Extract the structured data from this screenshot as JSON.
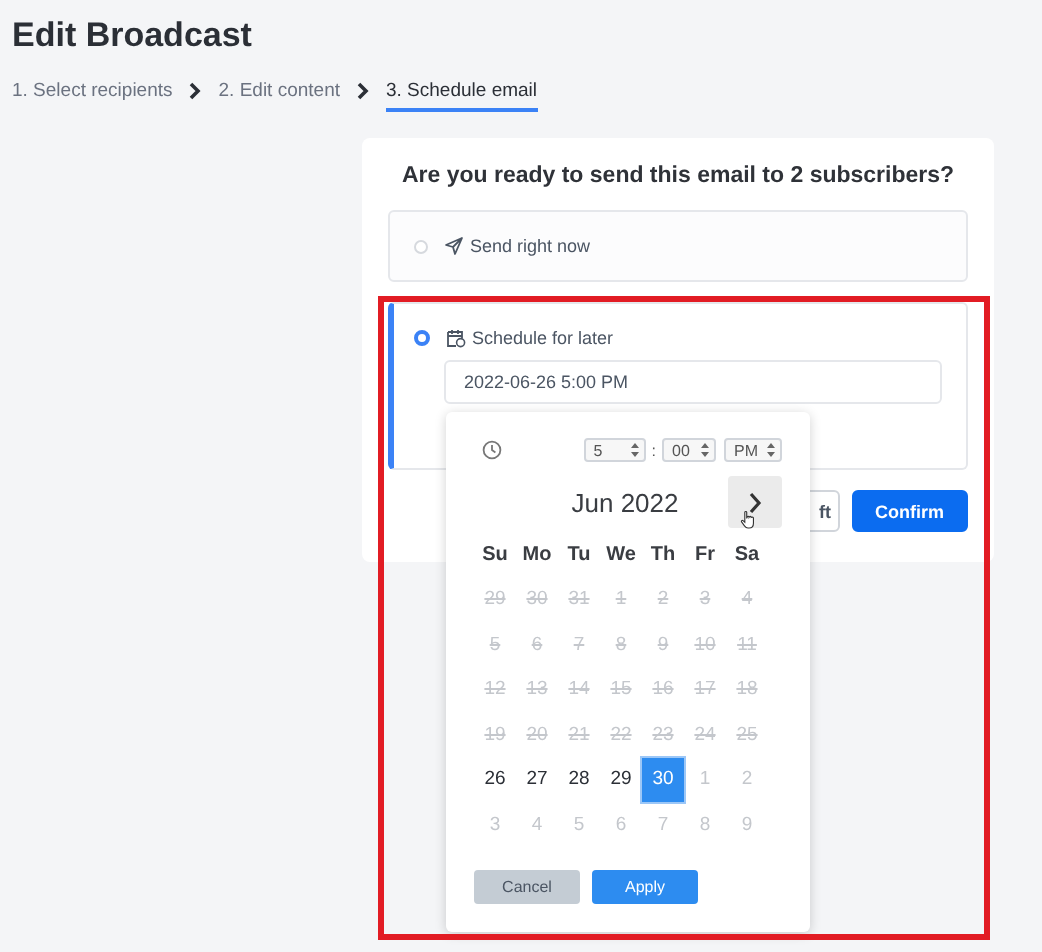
{
  "page": {
    "title": "Edit Broadcast"
  },
  "steps": [
    {
      "label": "1. Select recipients",
      "selected": false
    },
    {
      "label": "2. Edit content",
      "selected": false
    },
    {
      "label": "3. Schedule email",
      "selected": true
    }
  ],
  "card": {
    "question": "Are you ready to send this email to 2 subscribers?",
    "options": [
      {
        "kind": "now",
        "label": "Send right now",
        "selected": false
      },
      {
        "kind": "scheduled",
        "label": "Schedule for later",
        "selected": true,
        "value": "2022-06-26 5:00 PM"
      }
    ],
    "buttons": [
      {
        "label": "ft",
        "kind": "secondary"
      },
      {
        "label": "Confirm",
        "kind": "primary"
      }
    ]
  },
  "datepicker": {
    "hour": "5",
    "separator": ":",
    "minute": "00",
    "period": "PM",
    "month": "Jun 2022",
    "weekdays": [
      "Su",
      "Mo",
      "Tu",
      "We",
      "Th",
      "Fr",
      "Sa"
    ],
    "days": [
      {
        "label": "29",
        "kind": "disabled",
        "selected": false
      },
      {
        "label": "30",
        "kind": "disabled",
        "selected": false
      },
      {
        "label": "31",
        "kind": "disabled",
        "selected": false
      },
      {
        "label": "1",
        "kind": "disabled",
        "selected": false
      },
      {
        "label": "2",
        "kind": "disabled",
        "selected": false
      },
      {
        "label": "3",
        "kind": "disabled",
        "selected": false
      },
      {
        "label": "4",
        "kind": "disabled",
        "selected": false
      },
      {
        "label": "5",
        "kind": "disabled",
        "selected": false
      },
      {
        "label": "6",
        "kind": "disabled",
        "selected": false
      },
      {
        "label": "7",
        "kind": "disabled",
        "selected": false
      },
      {
        "label": "8",
        "kind": "disabled",
        "selected": false
      },
      {
        "label": "9",
        "kind": "disabled",
        "selected": false
      },
      {
        "label": "10",
        "kind": "disabled",
        "selected": false
      },
      {
        "label": "11",
        "kind": "disabled",
        "selected": false
      },
      {
        "label": "12",
        "kind": "disabled",
        "selected": false
      },
      {
        "label": "13",
        "kind": "disabled",
        "selected": false
      },
      {
        "label": "14",
        "kind": "disabled",
        "selected": false
      },
      {
        "label": "15",
        "kind": "disabled",
        "selected": false
      },
      {
        "label": "16",
        "kind": "disabled",
        "selected": false
      },
      {
        "label": "17",
        "kind": "disabled",
        "selected": false
      },
      {
        "label": "18",
        "kind": "disabled",
        "selected": false
      },
      {
        "label": "19",
        "kind": "disabled",
        "selected": false
      },
      {
        "label": "20",
        "kind": "disabled",
        "selected": false
      },
      {
        "label": "21",
        "kind": "disabled",
        "selected": false
      },
      {
        "label": "22",
        "kind": "disabled",
        "selected": false
      },
      {
        "label": "23",
        "kind": "disabled",
        "selected": false
      },
      {
        "label": "24",
        "kind": "disabled",
        "selected": false
      },
      {
        "label": "25",
        "kind": "disabled",
        "selected": false
      },
      {
        "label": "26",
        "kind": "day",
        "selected": false
      },
      {
        "label": "27",
        "kind": "day",
        "selected": false
      },
      {
        "label": "28",
        "kind": "day",
        "selected": false
      },
      {
        "label": "29",
        "kind": "day",
        "selected": false
      },
      {
        "label": "30",
        "kind": "day",
        "selected": true
      },
      {
        "label": "1",
        "kind": "outside",
        "selected": false
      },
      {
        "label": "2",
        "kind": "outside",
        "selected": false
      },
      {
        "label": "3",
        "kind": "outside",
        "selected": false
      },
      {
        "label": "4",
        "kind": "outside",
        "selected": false
      },
      {
        "label": "5",
        "kind": "outside",
        "selected": false
      },
      {
        "label": "6",
        "kind": "outside",
        "selected": false
      },
      {
        "label": "7",
        "kind": "outside",
        "selected": false
      },
      {
        "label": "8",
        "kind": "outside",
        "selected": false
      },
      {
        "label": "9",
        "kind": "outside",
        "selected": false
      }
    ],
    "buttons": [
      {
        "label": "Cancel",
        "kind": "secondary"
      },
      {
        "label": "Apply",
        "kind": "primary"
      }
    ]
  },
  "annotation": {
    "kind": "highlight-frame"
  }
}
